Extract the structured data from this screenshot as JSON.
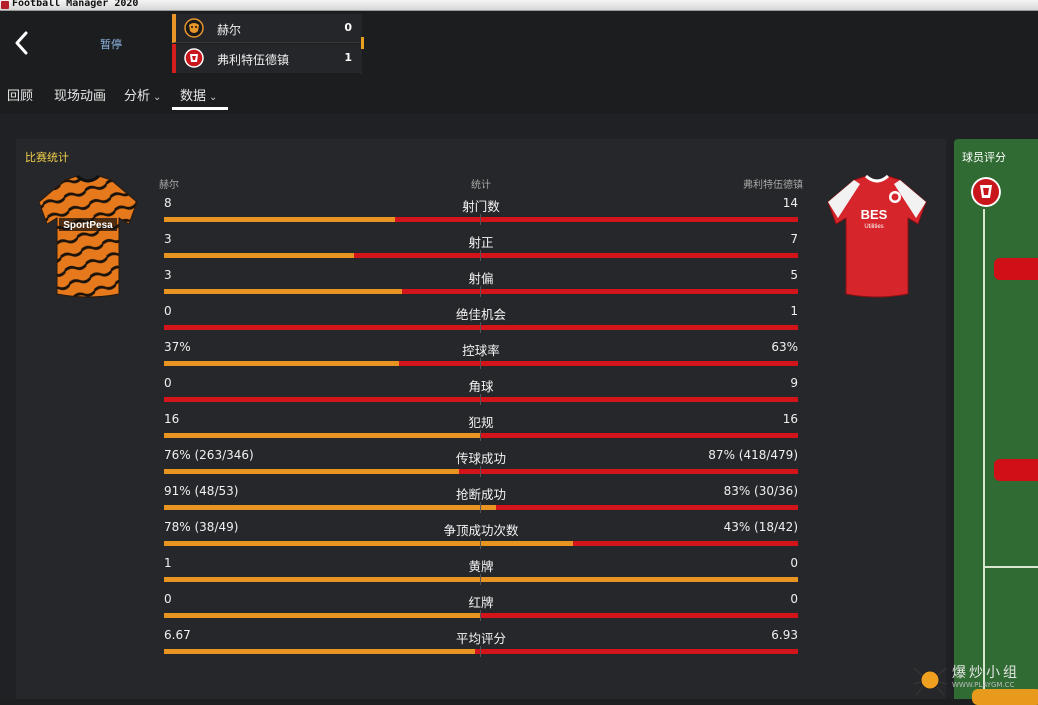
{
  "window": {
    "title": "Football Manager 2020"
  },
  "header": {
    "pause_label": "暂停",
    "home": {
      "name": "赫尔",
      "score": "0",
      "color": "#e8962a"
    },
    "away": {
      "name": "弗利特伍德镇",
      "score": "1",
      "color": "#d31c1c"
    }
  },
  "tabs": [
    {
      "label": "回顾",
      "has_chevron": false,
      "active": false
    },
    {
      "label": "现场动画",
      "has_chevron": false,
      "active": false
    },
    {
      "label": "分析",
      "has_chevron": true,
      "active": false
    },
    {
      "label": "数据",
      "has_chevron": true,
      "active": true
    }
  ],
  "stats": {
    "title": "比赛统计",
    "home_header": "赫尔",
    "mid_header": "统计",
    "away_header": "弗利特伍德镇",
    "home_color": "#e89420",
    "away_color": "#d3141a",
    "home_kit_sponsor": "SportPesa",
    "away_kit_sponsor": "BES",
    "away_kit_sponsor_sub": "Utilities",
    "rows": [
      {
        "home": "8",
        "label": "射门数",
        "away": "14",
        "home_share": 0.364
      },
      {
        "home": "3",
        "label": "射正",
        "away": "7",
        "home_share": 0.3
      },
      {
        "home": "3",
        "label": "射偏",
        "away": "5",
        "home_share": 0.375
      },
      {
        "home": "0",
        "label": "绝佳机会",
        "away": "1",
        "home_share": 0.0
      },
      {
        "home": "37%",
        "label": "控球率",
        "away": "63%",
        "home_share": 0.37
      },
      {
        "home": "0",
        "label": "角球",
        "away": "9",
        "home_share": 0.0
      },
      {
        "home": "16",
        "label": "犯规",
        "away": "16",
        "home_share": 0.5
      },
      {
        "home": "76% (263/346)",
        "label": "传球成功",
        "away": "87% (418/479)",
        "home_share": 0.466
      },
      {
        "home": "91% (48/53)",
        "label": "抢断成功",
        "away": "83% (30/36)",
        "home_share": 0.523
      },
      {
        "home": "78% (38/49)",
        "label": "争顶成功次数",
        "away": "43% (18/42)",
        "home_share": 0.645
      },
      {
        "home": "1",
        "label": "黄牌",
        "away": "0",
        "home_share": 1.0
      },
      {
        "home": "0",
        "label": "红牌",
        "away": "0",
        "home_share": 0.5
      },
      {
        "home": "6.67",
        "label": "平均评分",
        "away": "6.93",
        "home_share": 0.49
      }
    ]
  },
  "ratings": {
    "title": "球员评分"
  },
  "watermark": {
    "text": "爆炒小组",
    "sub": "WWW.PLAYGM.CC"
  }
}
